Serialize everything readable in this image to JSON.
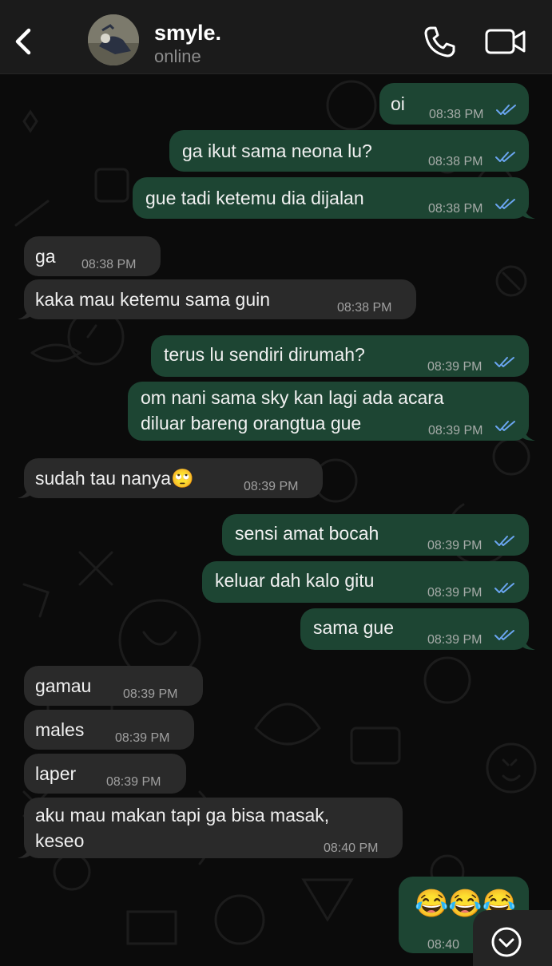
{
  "contact": {
    "name": "smyle.",
    "status": "online"
  },
  "messages": [
    {
      "dir": "out",
      "text": "oi",
      "time": "08:38 PM",
      "read": true
    },
    {
      "dir": "out",
      "text": "ga ikut sama neona lu?",
      "time": "08:38 PM",
      "read": true
    },
    {
      "dir": "out",
      "text": "gue tadi ketemu dia dijalan",
      "time": "08:38 PM",
      "read": true
    },
    {
      "dir": "in",
      "text": "ga",
      "time": "08:38 PM"
    },
    {
      "dir": "in",
      "text": "kaka mau ketemu sama guin",
      "time": "08:38 PM"
    },
    {
      "dir": "out",
      "text": "terus lu sendiri dirumah?",
      "time": "08:39 PM",
      "read": true
    },
    {
      "dir": "out",
      "text": "om nani sama sky kan lagi ada acara\ndiluar bareng orangtua gue",
      "time": "08:39 PM",
      "read": true
    },
    {
      "dir": "in",
      "text": "sudah tau nanya🙄",
      "time": "08:39 PM"
    },
    {
      "dir": "out",
      "text": "sensi amat bocah",
      "time": "08:39 PM",
      "read": true
    },
    {
      "dir": "out",
      "text": "keluar dah kalo gitu",
      "time": "08:39 PM",
      "read": true
    },
    {
      "dir": "out",
      "text": "sama gue",
      "time": "08:39 PM",
      "read": true
    },
    {
      "dir": "in",
      "text": "gamau",
      "time": "08:39 PM"
    },
    {
      "dir": "in",
      "text": "males",
      "time": "08:39 PM"
    },
    {
      "dir": "in",
      "text": "laper",
      "time": "08:39 PM"
    },
    {
      "dir": "in",
      "text": "aku mau makan tapi ga bisa masak,\nkeseo",
      "time": "08:40 PM"
    },
    {
      "dir": "out",
      "text": "😂😂😂",
      "time": "08:40",
      "read": false
    }
  ],
  "icons": {
    "back": "chevron-left-icon",
    "call": "phone-icon",
    "video": "video-camera-icon",
    "scroll": "chevron-down-icon"
  },
  "colors": {
    "outgoing_bubble": "#1d4533",
    "incoming_bubble": "#2a2a2a",
    "read_ticks": "#6aa5f0"
  }
}
